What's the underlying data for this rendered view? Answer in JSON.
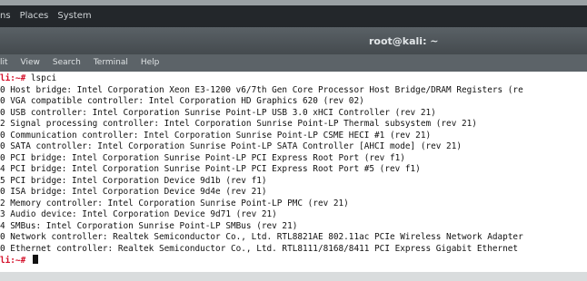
{
  "top_panel": {
    "menu": [
      "ns",
      "Places",
      "System"
    ]
  },
  "window": {
    "title": "root@kali: ~"
  },
  "menu_bar": {
    "items": [
      "lit",
      "View",
      "Search",
      "Terminal",
      "Help"
    ]
  },
  "terminal": {
    "prompt": "li:~#",
    "command": "lspci",
    "output": [
      "0 Host bridge: Intel Corporation Xeon E3-1200 v6/7th Gen Core Processor Host Bridge/DRAM Registers (re",
      "0 VGA compatible controller: Intel Corporation HD Graphics 620 (rev 02)",
      "0 USB controller: Intel Corporation Sunrise Point-LP USB 3.0 xHCI Controller (rev 21)",
      "2 Signal processing controller: Intel Corporation Sunrise Point-LP Thermal subsystem (rev 21)",
      "0 Communication controller: Intel Corporation Sunrise Point-LP CSME HECI #1 (rev 21)",
      "0 SATA controller: Intel Corporation Sunrise Point-LP SATA Controller [AHCI mode] (rev 21)",
      "0 PCI bridge: Intel Corporation Sunrise Point-LP PCI Express Root Port (rev f1)",
      "4 PCI bridge: Intel Corporation Sunrise Point-LP PCI Express Root Port #5 (rev f1)",
      "5 PCI bridge: Intel Corporation Device 9d1b (rev f1)",
      "0 ISA bridge: Intel Corporation Device 9d4e (rev 21)",
      "2 Memory controller: Intel Corporation Sunrise Point-LP PMC (rev 21)",
      "3 Audio device: Intel Corporation Device 9d71 (rev 21)",
      "4 SMBus: Intel Corporation Sunrise Point-LP SMBus (rev 21)",
      "0 Network controller: Realtek Semiconductor Co., Ltd. RTL8821AE 802.11ac PCIe Wireless Network Adapter",
      "0 Ethernet controller: Realtek Semiconductor Co., Ltd. RTL8111/8168/8411 PCI Express Gigabit Ethernet"
    ],
    "final_prompt": "li:~#"
  },
  "colors": {
    "prompt": "#d4102a",
    "terminal_bg": "#ffffff",
    "titlebar": "#4b5155"
  }
}
